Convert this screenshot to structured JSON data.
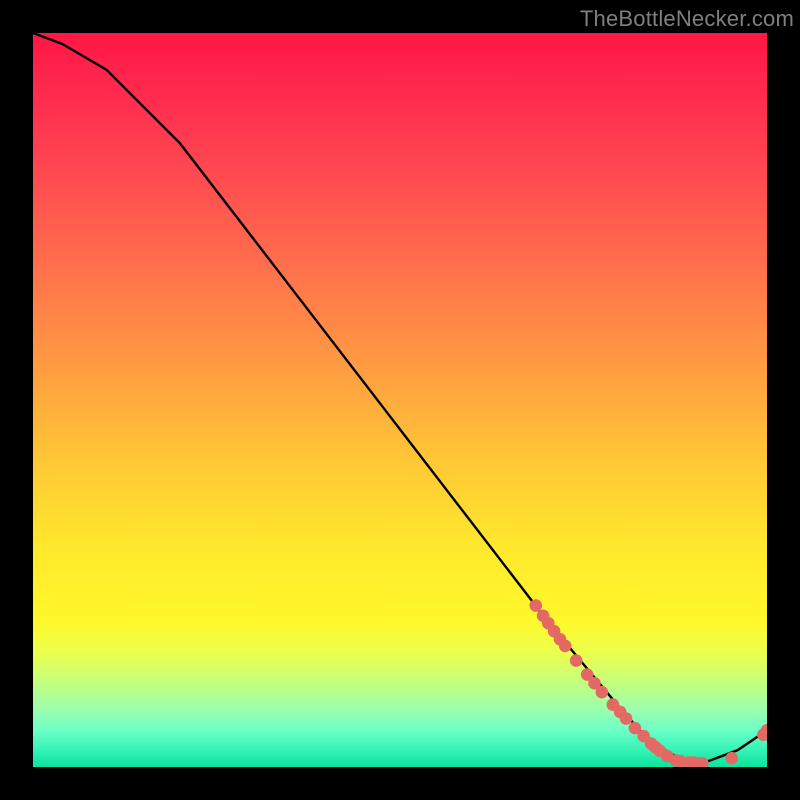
{
  "watermark": "TheBottleNecker.com",
  "chart_data": {
    "type": "line",
    "title": "",
    "xlabel": "",
    "ylabel": "",
    "xlim": [
      0,
      100
    ],
    "ylim": [
      0,
      100
    ],
    "grid": false,
    "legend": false,
    "series": [
      {
        "name": "curve",
        "style": "line",
        "color": "#000000",
        "x": [
          0,
          4,
          10,
          20,
          30,
          40,
          50,
          60,
          70,
          75,
          80,
          84,
          88,
          92,
          96,
          100
        ],
        "values": [
          100,
          98.5,
          95,
          85,
          72,
          59,
          46,
          33,
          20,
          14,
          8,
          3.5,
          1.2,
          0.8,
          2.3,
          5
        ]
      },
      {
        "name": "highlighted-points",
        "style": "scatter",
        "color": "#e36a64",
        "x": [
          68.5,
          69.5,
          70.2,
          71.0,
          71.8,
          72.5,
          74.0,
          75.5,
          76.5,
          77.5,
          79.0,
          80.0,
          80.8,
          82.0,
          83.2,
          84.2,
          84.8,
          85.4,
          86.4,
          87.6,
          88.2,
          89.4,
          90.0,
          90.6,
          91.2,
          95.2,
          99.5,
          100.0
        ],
        "values": [
          22.0,
          20.6,
          19.6,
          18.5,
          17.4,
          16.5,
          14.5,
          12.6,
          11.4,
          10.2,
          8.5,
          7.5,
          6.6,
          5.3,
          4.2,
          3.2,
          2.7,
          2.2,
          1.5,
          0.9,
          0.8,
          0.6,
          0.6,
          0.5,
          0.5,
          1.2,
          4.4,
          5.0
        ]
      }
    ]
  }
}
